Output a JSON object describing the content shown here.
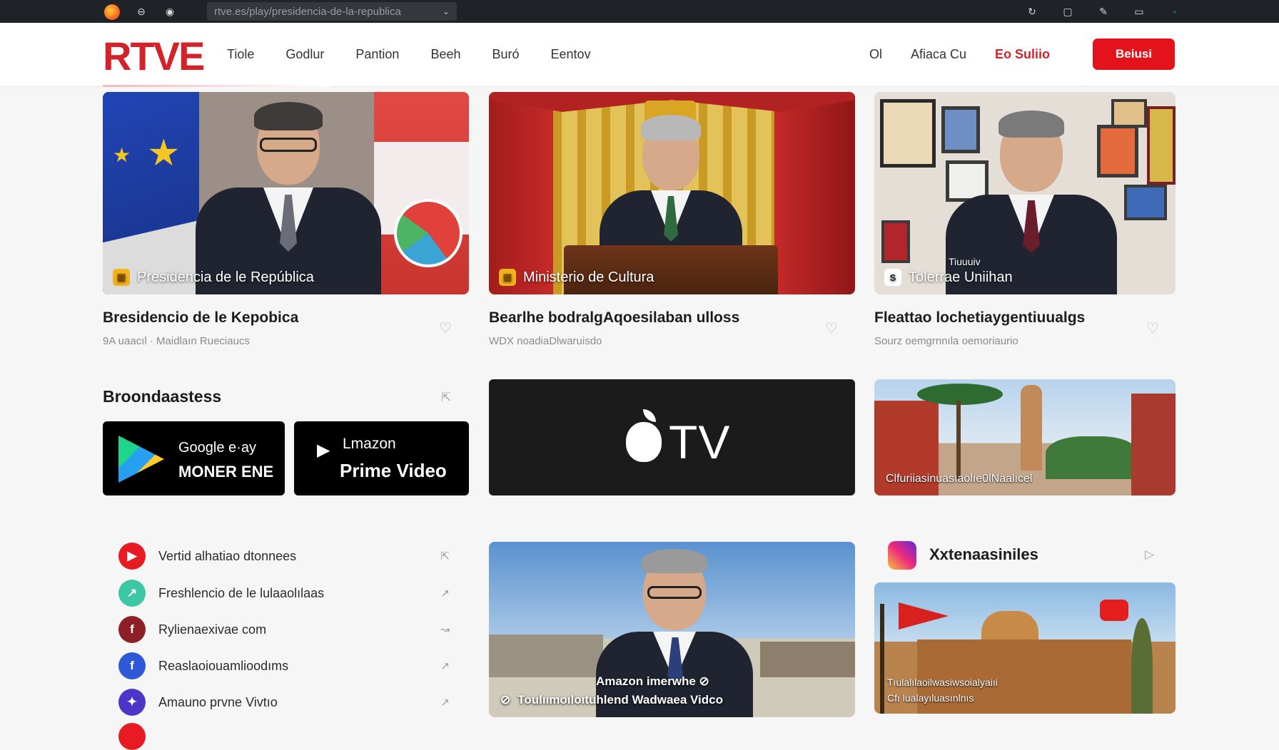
{
  "browser": {
    "url": "rtve.es/play/presidencia-de-la-republica",
    "icons": [
      "firefox-icon",
      "account-icon",
      "reload-icon",
      "history-icon",
      "tab-icon",
      "extension-icon",
      "window-icon",
      "menu-icon"
    ]
  },
  "header": {
    "logo": "RTVE",
    "nav": [
      "Tiole",
      "Godlur",
      "Pantion",
      "Beeh",
      "Buró",
      "Eentov"
    ],
    "right_links": [
      "Ol",
      "Afiaca Cu"
    ],
    "live_label": "Eo Suliio",
    "cta_label": "Beiusi",
    "accent": "#e3121b"
  },
  "cards": [
    {
      "caption": "Presidencia de le República",
      "title": "Bresidencio de le Kepobica",
      "subtitle": "9A uaacıl · Maidlaın Rueciaucs"
    },
    {
      "caption": "Ministerio de Cultura",
      "title": "Bearlhe bodralgAqoesilaban ulloss",
      "subtitle": "WDX noadiaDlwaruisdo"
    },
    {
      "caption": "Tolerrae Uniihan",
      "caption_top": "Tiuuuiv",
      "title": "Fleattao lochetiaygentiuualgs",
      "subtitle": "Sourz oemgrnnıla oemoriaurio"
    }
  ],
  "platforms": {
    "title": "Broondaastess",
    "google_top": "Google e·ay",
    "google_bottom": "MONER ENE",
    "amazon_top": "Lmazon",
    "amazon_bottom": "Prime Video",
    "appletv": "TV"
  },
  "plaza_caption": "Clfuriiasinuasıaolıe0lNaalıcel",
  "links": [
    {
      "label": "Vertid alhatiao dtonnees",
      "color": "#e81b23",
      "glyph": "▶"
    },
    {
      "label": "Freshlencio de le lulaaolılaas",
      "color": "#3ec7a4",
      "glyph": "↗"
    },
    {
      "label": "Rylienaexivae com",
      "color": "#8d1f27",
      "glyph": "f"
    },
    {
      "label": "Reaslaoiouamlioodıms",
      "color": "#2f58d6",
      "glyph": "f"
    },
    {
      "label": "Amauno prvne Vivtıo",
      "color": "#4c36c8",
      "glyph": "✦"
    }
  ],
  "featured_video": {
    "line1": "Amazon imerwhe ⊘",
    "line2": "Toulıımoıloıtuhlend Wadwaea Vidco"
  },
  "social": {
    "title": "Xxtenaasiniles",
    "card_caption1": "Tıulalılaoilwasiwsoialyaiıi",
    "card_caption2": "Cfı lualayıluasınlnıs"
  }
}
